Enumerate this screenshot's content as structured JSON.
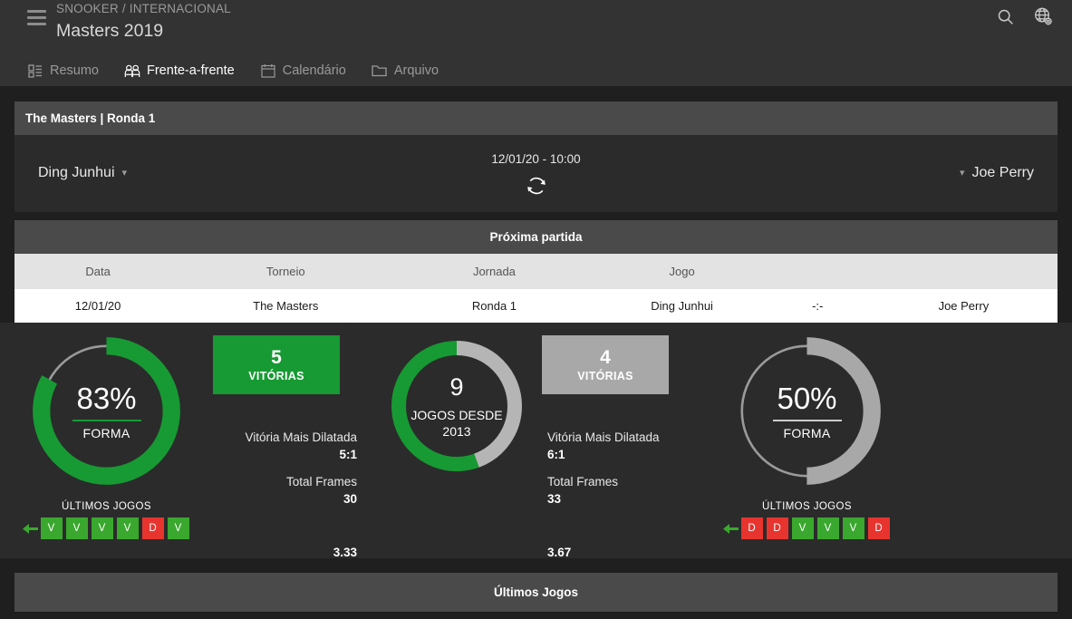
{
  "header": {
    "breadcrumb": "SNOOKER / INTERNACIONAL",
    "title": "Masters 2019",
    "menu_icon": "hamburger-icon",
    "search_icon": "search-icon",
    "language_icon": "globe-settings-icon",
    "tabs": [
      {
        "label": "Resumo",
        "icon": "dashboard-icon",
        "active": false
      },
      {
        "label": "Frente-a-frente",
        "icon": "two-people-icon",
        "active": true
      },
      {
        "label": "Calendário",
        "icon": "calendar-icon",
        "active": false
      },
      {
        "label": "Arquivo",
        "icon": "folder-icon",
        "active": false
      }
    ]
  },
  "match_panel": {
    "title": "The Masters | Ronda 1",
    "home_player": "Ding Junhui",
    "away_player": "Joe Perry",
    "datetime": "12/01/20 - 10:00",
    "refresh_icon": "refresh-icon",
    "chevron_icon": "chevron-down-icon"
  },
  "next_match": {
    "title": "Próxima partida",
    "columns": [
      "Data",
      "Torneio",
      "Jornada",
      "Jogo"
    ],
    "rows": [
      {
        "data": "12/01/20",
        "torneio": "The Masters",
        "jornada": "Ronda 1",
        "home": "Ding Junhui",
        "score": "-:-",
        "away": "Joe Perry"
      }
    ]
  },
  "stats": {
    "home": {
      "form_percent": "83%",
      "form_label": "FORMA",
      "form_value": 83,
      "recent_title": "ÚLTIMOS JOGOS",
      "recent": [
        "V",
        "V",
        "V",
        "V",
        "D",
        "V"
      ],
      "wins_number": "5",
      "wins_label": "VITÓRIAS",
      "biggest_win_key": "Vitória Mais Dilatada",
      "biggest_win_value": "5:1",
      "total_frames_key": "Total Frames",
      "total_frames_value": "30",
      "extra_value": "3.33"
    },
    "center": {
      "games_number": "9",
      "games_line1": "JOGOS DESDE",
      "games_line2": "2013",
      "home_share": 5,
      "away_share": 4
    },
    "away": {
      "form_percent": "50%",
      "form_label": "FORMA",
      "form_value": 50,
      "recent_title": "ÚLTIMOS JOGOS",
      "recent": [
        "D",
        "D",
        "V",
        "V",
        "V",
        "D"
      ],
      "wins_number": "4",
      "wins_label": "VITÓRIAS",
      "biggest_win_key": "Vitória Mais Dilatada",
      "biggest_win_value": "6:1",
      "total_frames_key": "Total Frames",
      "total_frames_value": "33",
      "extra_value": "3.67"
    }
  },
  "last_games": {
    "title": "Últimos Jogos"
  },
  "colors": {
    "green": "#179a33",
    "chip_green": "#3aa82e",
    "chip_red": "#e8342f",
    "gray": "#a8a8a8",
    "panel_head": "#4a4a4a",
    "panel_bg": "#2b2b2b",
    "page_bg": "#1f1f1f",
    "topbar_bg": "#333333"
  }
}
